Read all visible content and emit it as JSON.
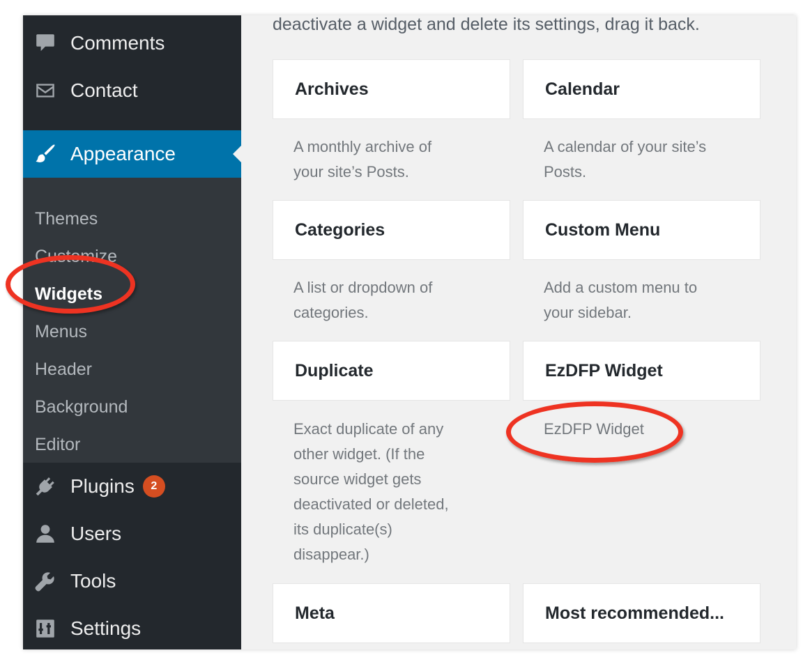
{
  "intro_text": "deactivate a widget and delete its settings, drag it back.",
  "sidebar": {
    "items": [
      {
        "label": "Comments",
        "icon": "comment-icon"
      },
      {
        "label": "Contact",
        "icon": "envelope-icon"
      },
      {
        "label": "Appearance",
        "icon": "paintbrush-icon",
        "active": true
      },
      {
        "label": "Plugins",
        "icon": "plugin-icon",
        "badge": "2"
      },
      {
        "label": "Users",
        "icon": "user-icon"
      },
      {
        "label": "Tools",
        "icon": "wrench-icon"
      },
      {
        "label": "Settings",
        "icon": "settings-icon"
      }
    ],
    "submenu": [
      "Themes",
      "Customize",
      "Widgets",
      "Menus",
      "Header",
      "Background",
      "Editor"
    ],
    "current_submenu": "Widgets"
  },
  "widgets": [
    {
      "title": "Archives",
      "description": [
        "A monthly archive of",
        "your site’s Posts."
      ]
    },
    {
      "title": "Calendar",
      "description": [
        "A calendar of your site’s",
        "Posts."
      ]
    },
    {
      "title": "Categories",
      "description": [
        "A list or dropdown of",
        "categories."
      ]
    },
    {
      "title": "Custom Menu",
      "description": [
        "Add a custom menu to",
        "your sidebar."
      ]
    },
    {
      "title": "Duplicate",
      "description": [
        "Exact duplicate of any",
        "other widget. (If the",
        "source widget gets",
        "deactivated or deleted,",
        "its duplicate(s)",
        "disappear.)"
      ]
    },
    {
      "title": "EzDFP Widget",
      "description": [
        "EzDFP Widget"
      ]
    },
    {
      "title": "Meta",
      "description": []
    },
    {
      "title": "Most recommended...",
      "description": []
    }
  ],
  "colors": {
    "sidebar_bg": "#23282d",
    "submenu_bg": "#32373c",
    "active_bg": "#0073aa",
    "badge_bg": "#d54e21",
    "annotation": "#ee3322",
    "content_bg": "#f1f1f1"
  }
}
